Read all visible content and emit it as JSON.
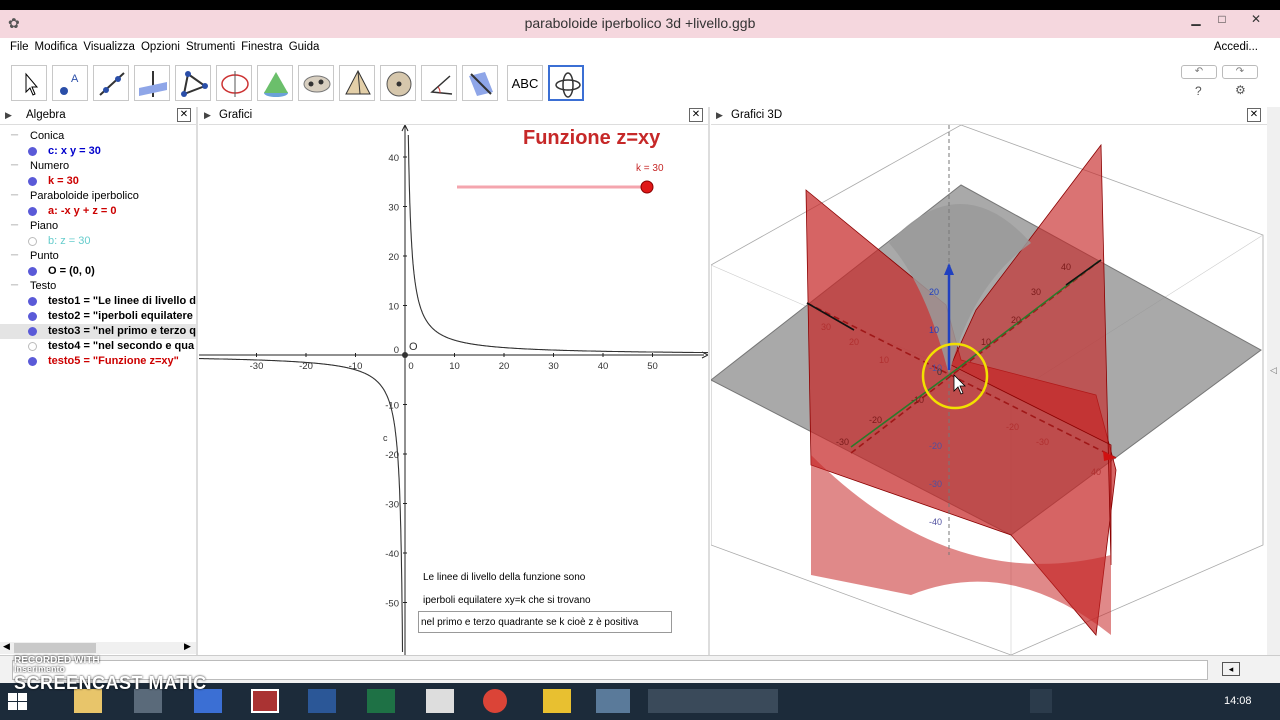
{
  "window": {
    "title": "paraboloide iperbolico 3d +livello.ggb"
  },
  "menu": {
    "items": [
      "File",
      "Modifica",
      "Visualizza",
      "Opzioni",
      "Strumenti",
      "Finestra",
      "Guida"
    ],
    "login": "Accedi..."
  },
  "toolbar": {
    "tools": [
      "move-tool",
      "point-tool",
      "line-tool",
      "perpendicular-tool",
      "polygon-tool",
      "circle-tool",
      "cone-tool",
      "conic-tool",
      "pyramid-tool",
      "sphere-tool",
      "angle-tool",
      "reflect-tool",
      "text-tool",
      "rotate-view-tool"
    ],
    "text_tool_label": "ABC",
    "help": "?",
    "settings_icon": "gear-icon"
  },
  "panels": {
    "algebra": "Algebra",
    "graphics": "Grafici",
    "graphics3d": "Grafici 3D"
  },
  "algebra": {
    "groups": [
      {
        "category": "Conica",
        "items": [
          {
            "text": "c: x y = 30",
            "color": "#0000cc"
          }
        ]
      },
      {
        "category": "Numero",
        "items": [
          {
            "text": "k = 30",
            "color": "#cc0000"
          }
        ]
      },
      {
        "category": "Paraboloide iperbolico",
        "items": [
          {
            "text": "a: -x y + z = 0",
            "color": "#cc0000"
          }
        ]
      },
      {
        "category": "Piano",
        "items": [
          {
            "text": "b: z = 30",
            "color": "#66cccc"
          }
        ]
      },
      {
        "category": "Punto",
        "items": [
          {
            "text": "O = (0, 0)",
            "color": "#000000"
          }
        ]
      },
      {
        "category": "Testo",
        "items": [
          {
            "text": "testo1 = \"Le linee di livello d",
            "color": "#000000"
          },
          {
            "text": "testo2 = \"iperboli equilatere",
            "color": "#000000"
          },
          {
            "text": "testo3 = \"nel primo e terzo q",
            "color": "#000000"
          },
          {
            "text": "testo4 = \"nel secondo e qua",
            "color": "#000000"
          },
          {
            "text": "testo5 = \"Funzione z=xy\"",
            "color": "#cc0000"
          }
        ]
      }
    ]
  },
  "graphics": {
    "heading": "Funzione z=xy",
    "slider_label": "k = 30",
    "k": 30,
    "origin_label": "O",
    "c_label": "c",
    "x_ticks": [
      "-30",
      "-20",
      "-10",
      "0",
      "10",
      "20",
      "30",
      "40",
      "50"
    ],
    "y_ticks": [
      "40",
      "30",
      "20",
      "10",
      "0",
      "-10",
      "-20",
      "-30",
      "-40",
      "-50"
    ],
    "text_lines": [
      "Le linee di livello della funzione sono",
      "iperboli equilatere xy=k che si trovano",
      "nel primo e terzo quadrante se k cioè z è positiva"
    ]
  },
  "g3d": {
    "z_ticks": [
      "20",
      "10",
      "0",
      "-10",
      "-20",
      "-30",
      "-40"
    ],
    "axis_ticks_a": [
      "40",
      "30",
      "20",
      "10",
      "-10",
      "-20",
      "-30"
    ],
    "axis_ticks_b": [
      "30",
      "20",
      "10",
      "-20",
      "-30",
      "40"
    ]
  },
  "watermark": {
    "line1": "RECORDED WITH",
    "line2": "Inserimento",
    "brand": "SCREENCAST MATIC"
  },
  "taskbar": {
    "clock": "14:08"
  },
  "colors": {
    "titlebar": "#f5d7de",
    "surface": "#c62828",
    "plane": "#888888",
    "accent": "#3b6fd4"
  }
}
